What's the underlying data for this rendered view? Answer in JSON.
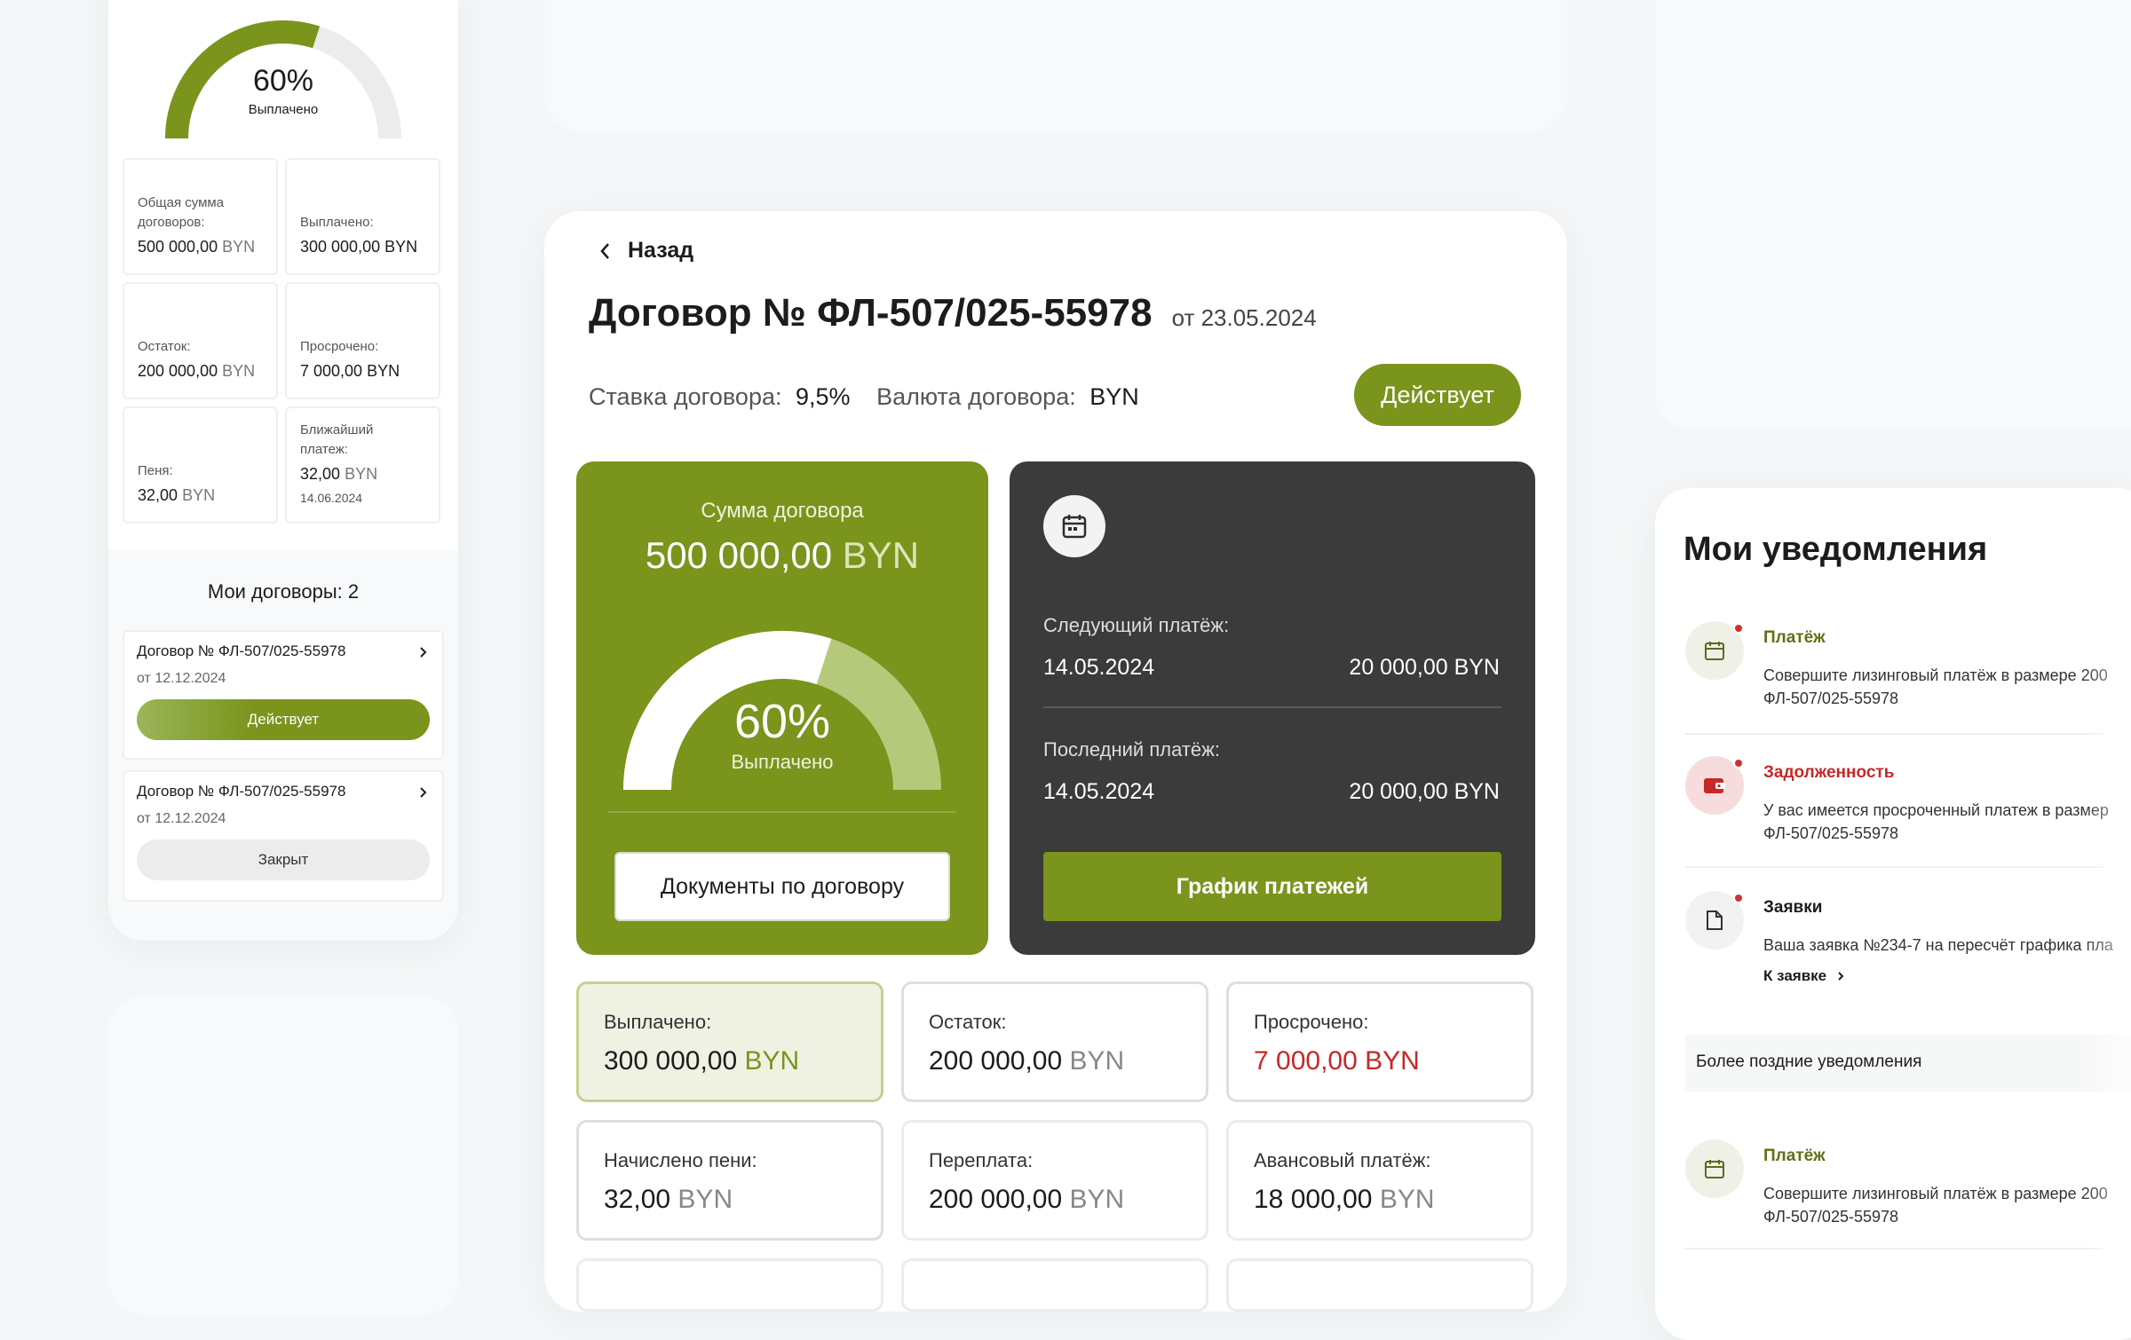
{
  "left": {
    "gauge": {
      "percent": "60%",
      "label": "Выплачено",
      "value": 0.6
    },
    "cells": [
      {
        "label": "Общая сумма договоров:",
        "amount": "500 000,00",
        "cur": "BYN"
      },
      {
        "label": "Выплачено:",
        "amount": "300 000,00",
        "cur": "BYN"
      },
      {
        "label": "Остаток:",
        "amount": "200 000,00",
        "cur": "BYN"
      },
      {
        "label": "Просрочено:",
        "amount": "7 000,00",
        "cur": "BYN"
      },
      {
        "label": "Пеня:",
        "amount": "32,00",
        "cur": "BYN"
      },
      {
        "label": "Ближайший платеж:",
        "amount": "32,00",
        "cur": "BYN",
        "date": "14.06.2024"
      }
    ],
    "contracts_title": "Мои договоры: 2",
    "contracts": [
      {
        "title": "Договор № ФЛ-507/025-55978",
        "date": "от 12.12.2024",
        "status": "Действует"
      },
      {
        "title": "Договор № ФЛ-507/025-55978",
        "date": "от 12.12.2024",
        "status": "Закрыт"
      }
    ]
  },
  "main": {
    "back": "Назад",
    "title": "Договор № ФЛ-507/025-55978",
    "date": "от 23.05.2024",
    "rate_label": "Ставка договора:",
    "rate": "9,5%",
    "currency_label": "Валюта договора:",
    "currency": "BYN",
    "status": "Действует",
    "sum_label": "Сумма договора",
    "sum_amount": "500 000,00",
    "sum_cur": "BYN",
    "gauge": {
      "percent": "60%",
      "label": "Выплачено",
      "value": 0.6
    },
    "docs_button": "Документы по договору",
    "next_label": "Следующий платёж:",
    "next_date": "14.05.2024",
    "next_amount": "20 000,00 BYN",
    "last_label": "Последний платёж:",
    "last_date": "14.05.2024",
    "last_amount": "20 000,00 BYN",
    "schedule_button": "График платежей",
    "stats": [
      {
        "label": "Выплачено:",
        "amount": "300 000,00",
        "cur": "BYN"
      },
      {
        "label": "Остаток:",
        "amount": "200 000,00",
        "cur": "BYN"
      },
      {
        "label": "Просрочено:",
        "amount": "7 000,00",
        "cur": "BYN"
      },
      {
        "label": "Начислено пени:",
        "amount": "32,00",
        "cur": "BYN"
      },
      {
        "label": "Переплата:",
        "amount": "200 000,00",
        "cur": "BYN"
      },
      {
        "label": "Авансовый платёж:",
        "amount": "18 000,00",
        "cur": "BYN"
      }
    ]
  },
  "notifications": {
    "title": "Мои уведомления",
    "items": [
      {
        "title": "Платёж",
        "text1": "Совершите лизинговый платёж в размере 200",
        "text2": "ФЛ-507/025-55978"
      },
      {
        "title": "Задолженность",
        "text1": "У вас имеется просроченный платеж в размер",
        "text2": "ФЛ-507/025-55978"
      },
      {
        "title": "Заявки",
        "text1": "Ваша заявка №234-7 на пересчёт графика пла",
        "link": "К заявке"
      }
    ],
    "later": "Более поздние уведомления",
    "later_item": {
      "title": "Платёж",
      "text1": "Совершите лизинговый платёж в размере 200",
      "text2": "ФЛ-507/025-55978"
    }
  },
  "colors": {
    "accent": "#7a941c",
    "dark_card": "#3b3b3b",
    "danger": "#c62828"
  }
}
